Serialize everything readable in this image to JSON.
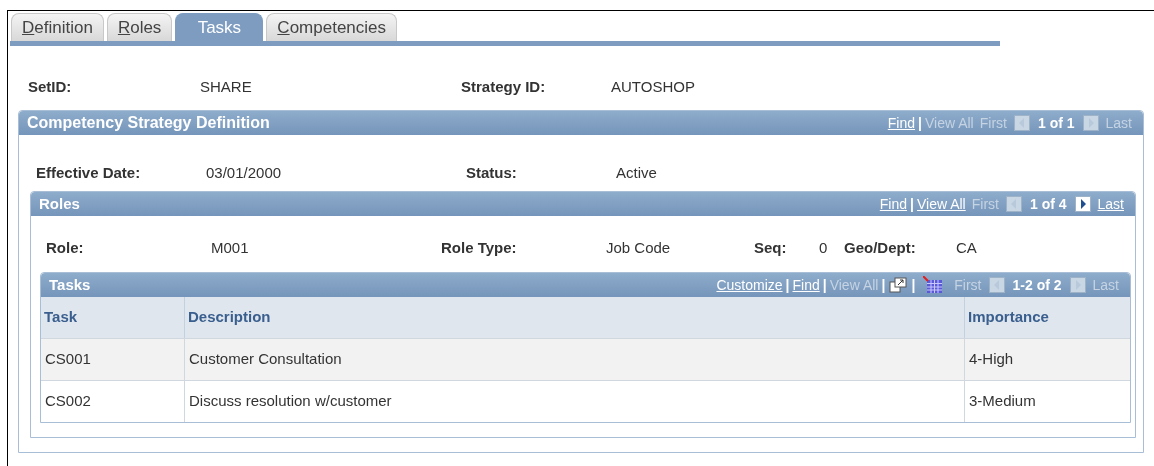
{
  "tabs": [
    {
      "label": "Definition",
      "selected": false,
      "access_key": true
    },
    {
      "label": "Roles",
      "selected": false,
      "access_key": true
    },
    {
      "label": "Tasks",
      "selected": true,
      "access_key": false
    },
    {
      "label": "Competencies",
      "selected": false,
      "access_key": true
    }
  ],
  "header_fields": [
    {
      "label": "SetID:",
      "value": "SHARE"
    },
    {
      "label": "Strategy ID:",
      "value": "AUTOSHOP"
    }
  ],
  "strategy_section": {
    "title": "Competency Strategy Definition",
    "nav": [
      {
        "kind": "link",
        "label": "Find",
        "enabled": true
      },
      {
        "kind": "sep",
        "label": "|"
      },
      {
        "kind": "link",
        "label": "View All",
        "enabled": false
      },
      {
        "kind": "link",
        "label": "First",
        "enabled": false
      },
      {
        "kind": "prev",
        "enabled": false
      },
      {
        "kind": "count",
        "label": "1 of 1"
      },
      {
        "kind": "next",
        "enabled": false
      },
      {
        "kind": "link",
        "label": "Last",
        "enabled": false
      }
    ],
    "fields": [
      {
        "label": "Effective Date:",
        "value": "03/01/2000"
      },
      {
        "label": "Status:",
        "value": "Active"
      }
    ],
    "roles_section": {
      "title": "Roles",
      "nav": [
        {
          "kind": "link",
          "label": "Find",
          "enabled": true
        },
        {
          "kind": "sep",
          "label": "|"
        },
        {
          "kind": "link",
          "label": "View All",
          "enabled": true
        },
        {
          "kind": "link",
          "label": "First",
          "enabled": false
        },
        {
          "kind": "prev",
          "enabled": false
        },
        {
          "kind": "count",
          "label": "1 of 4"
        },
        {
          "kind": "next",
          "enabled": true
        },
        {
          "kind": "link",
          "label": "Last",
          "enabled": true
        }
      ],
      "fields": [
        {
          "label": "Role:",
          "value": "M001"
        },
        {
          "label": "Role Type:",
          "value": "Job Code"
        },
        {
          "label": "Seq:",
          "value": "0"
        },
        {
          "label": "Geo/Dept:",
          "value": "CA"
        }
      ],
      "tasks_grid": {
        "title": "Tasks",
        "nav": [
          {
            "kind": "link",
            "label": "Customize",
            "enabled": true
          },
          {
            "kind": "sep",
            "label": "|"
          },
          {
            "kind": "link",
            "label": "Find",
            "enabled": true
          },
          {
            "kind": "sep",
            "label": "|"
          },
          {
            "kind": "link",
            "label": "View All",
            "enabled": false
          },
          {
            "kind": "sep",
            "label": "|"
          },
          {
            "kind": "zoom"
          },
          {
            "kind": "sep",
            "label": "|"
          },
          {
            "kind": "download"
          },
          {
            "kind": "link",
            "label": "First",
            "enabled": false
          },
          {
            "kind": "prev",
            "enabled": false
          },
          {
            "kind": "count",
            "label": "1-2 of 2"
          },
          {
            "kind": "next",
            "enabled": false
          },
          {
            "kind": "link",
            "label": "Last",
            "enabled": false
          }
        ],
        "columns": [
          "Task",
          "Description",
          "Importance"
        ],
        "rows": [
          [
            "CS001",
            "Customer Consultation",
            "4-High"
          ],
          [
            "CS002",
            "Discuss resolution w/customer",
            "3-Medium"
          ]
        ]
      }
    }
  }
}
